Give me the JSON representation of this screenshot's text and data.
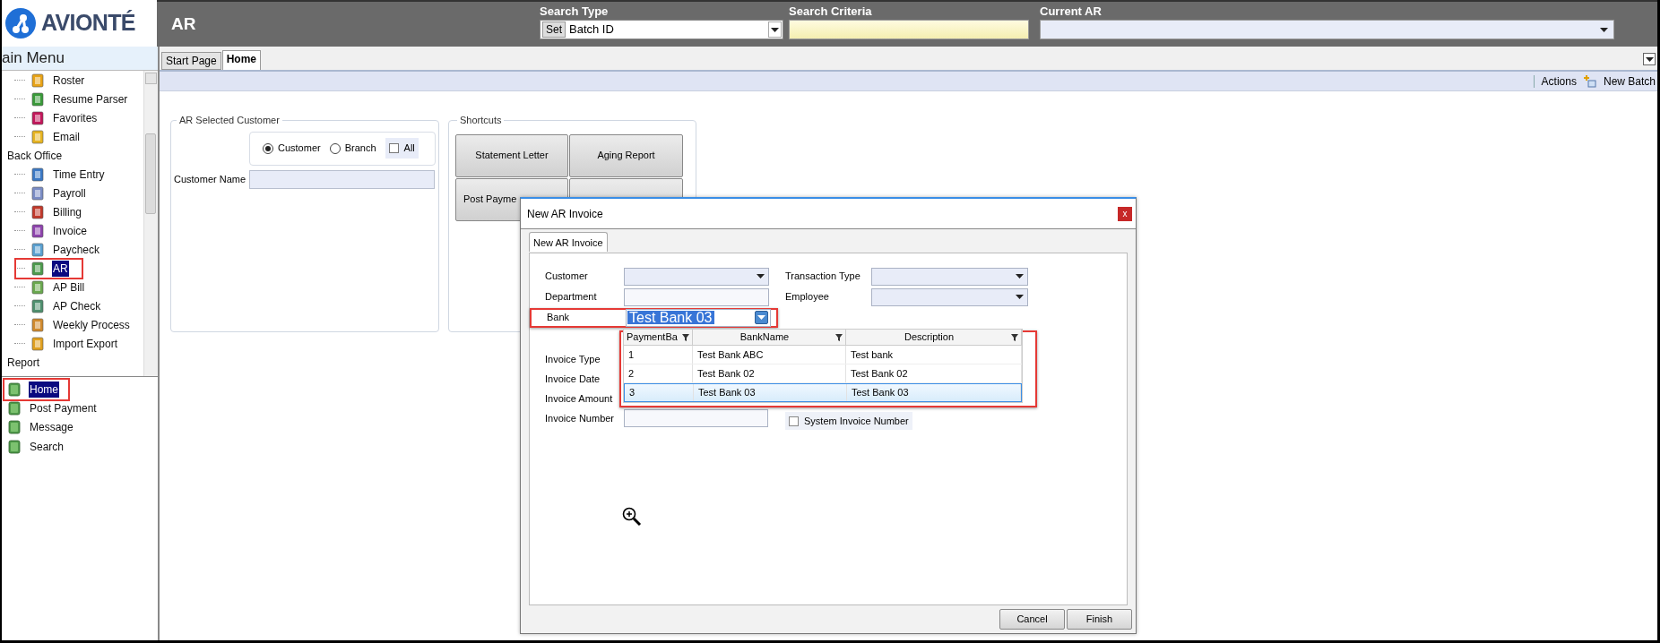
{
  "header": {
    "logo_text": "AVIONTÉ",
    "module_title": "AR",
    "search_type_label": "Search Type",
    "set_button": "Set",
    "search_type_value": "Batch ID",
    "criteria_label": "Search Criteria",
    "current_label": "Current AR"
  },
  "sidebar": {
    "title": "ain Menu",
    "tree": [
      {
        "label": "Roster",
        "kind": "item",
        "highlighted": false
      },
      {
        "label": "Resume Parser",
        "kind": "item",
        "highlighted": false
      },
      {
        "label": "Favorites",
        "kind": "item",
        "highlighted": false
      },
      {
        "label": "Email",
        "kind": "item",
        "highlighted": false
      },
      {
        "label": "Back Office",
        "kind": "group",
        "children": [
          {
            "label": "Time Entry",
            "selected": false,
            "highlighted": false
          },
          {
            "label": "Payroll",
            "selected": false,
            "highlighted": false
          },
          {
            "label": "Billing",
            "selected": false,
            "highlighted": false
          },
          {
            "label": "Invoice",
            "selected": false,
            "highlighted": false
          },
          {
            "label": "Paycheck",
            "selected": false,
            "highlighted": false
          },
          {
            "label": "AR",
            "selected": true,
            "highlighted": true
          },
          {
            "label": "AP Bill",
            "selected": false,
            "highlighted": false
          },
          {
            "label": "AP Check",
            "selected": false,
            "highlighted": false
          },
          {
            "label": "Weekly Process",
            "selected": false,
            "highlighted": false
          },
          {
            "label": "Import Export",
            "selected": false,
            "highlighted": false
          }
        ]
      },
      {
        "label": "Report",
        "kind": "group"
      }
    ],
    "links": [
      {
        "label": "Home",
        "selected": true,
        "highlighted": true
      },
      {
        "label": "Post Payment",
        "selected": false,
        "highlighted": false
      },
      {
        "label": "Message",
        "selected": false,
        "highlighted": false
      },
      {
        "label": "Search",
        "selected": false,
        "highlighted": false
      }
    ]
  },
  "tabs": [
    {
      "label": "Start Page",
      "selected": false
    },
    {
      "label": "Home",
      "selected": true
    }
  ],
  "toolbar": {
    "actions": "Actions",
    "new_batch": "New Batch"
  },
  "ar_customer": {
    "title": "AR Selected Customer",
    "radios": [
      {
        "label": "Customer",
        "selected": true
      },
      {
        "label": "Branch",
        "selected": false
      }
    ],
    "all": {
      "label": "All",
      "checked": false
    },
    "name_label": "Customer Name"
  },
  "shortcuts": {
    "title": "Shortcuts",
    "buttons": [
      "Statement Letter",
      "Aging Report",
      "Post Payme"
    ]
  },
  "dialog": {
    "title": "New AR Invoice",
    "close": "x",
    "tab": "New AR Invoice",
    "upper_rows": [
      {
        "left": {
          "label": "Customer",
          "kind": "combo"
        },
        "right": {
          "label": "Transaction Type",
          "kind": "combo"
        }
      },
      {
        "left": {
          "label": "Department",
          "kind": "text"
        },
        "right": {
          "label": "Employee",
          "kind": "combo"
        }
      },
      {
        "left": {
          "label": "Bank",
          "kind": "combo",
          "value": "Test Bank 03",
          "highlighted": true
        }
      }
    ],
    "lower_rows": [
      {
        "left": {
          "label": "Invoice Type"
        }
      },
      {
        "left": {
          "label": "Invoice Date"
        }
      },
      {
        "left": {
          "label": "Invoice Amount"
        }
      },
      {
        "left": {
          "label": "Invoice Number",
          "kind": "text"
        },
        "right": {
          "label": "System Invoice Number",
          "kind": "checkbox",
          "checked": false
        }
      }
    ],
    "dropdown": {
      "highlighted": true,
      "columns": [
        "PaymentBa",
        "BankName",
        "Description"
      ],
      "rows": [
        {
          "cells": [
            "1",
            "Test Bank ABC",
            "Test bank"
          ],
          "selected": false
        },
        {
          "cells": [
            "2",
            "Test Bank 02",
            "Test Bank 02"
          ],
          "selected": false
        },
        {
          "cells": [
            "3",
            "Test Bank 03",
            "Test Bank 03"
          ],
          "selected": true
        }
      ]
    },
    "buttons": [
      "Cancel",
      "Finish"
    ]
  }
}
